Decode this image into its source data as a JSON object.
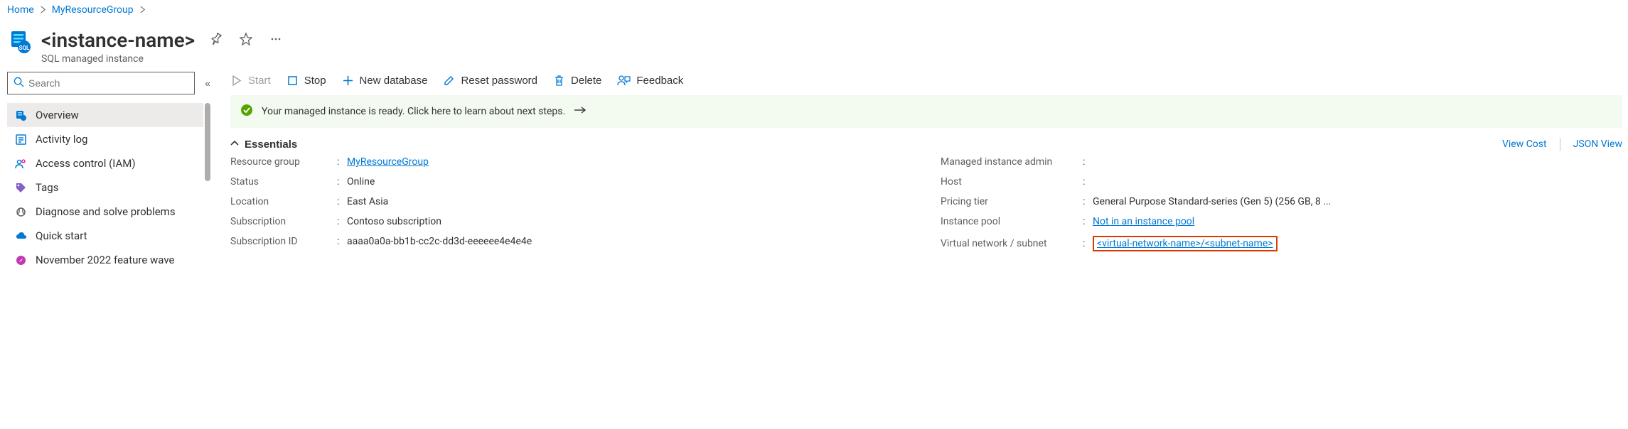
{
  "breadcrumb": {
    "home": "Home",
    "group": "MyResourceGroup"
  },
  "header": {
    "title": "<instance-name>",
    "subtitle": "SQL managed instance"
  },
  "search": {
    "placeholder": "Search",
    "collapse_glyph": "«"
  },
  "nav": {
    "items": [
      {
        "label": "Overview"
      },
      {
        "label": "Activity log"
      },
      {
        "label": "Access control (IAM)"
      },
      {
        "label": "Tags"
      },
      {
        "label": "Diagnose and solve problems"
      },
      {
        "label": "Quick start"
      },
      {
        "label": "November 2022 feature wave"
      }
    ]
  },
  "toolbar": {
    "start": "Start",
    "stop": "Stop",
    "new_database": "New database",
    "reset_password": "Reset password",
    "delete": "Delete",
    "feedback": "Feedback"
  },
  "alert": {
    "text": "Your managed instance is ready. Click here to learn about next steps."
  },
  "essentials": {
    "title": "Essentials",
    "view_cost": "View Cost",
    "json_view": "JSON View",
    "left": {
      "resource_group_label": "Resource group",
      "resource_group_value": "MyResourceGroup",
      "status_label": "Status",
      "status_value": "Online",
      "location_label": "Location",
      "location_value": "East Asia",
      "subscription_label": "Subscription",
      "subscription_value": "Contoso subscription",
      "subscription_id_label": "Subscription ID",
      "subscription_id_value": "aaaa0a0a-bb1b-cc2c-dd3d-eeeeee4e4e4e"
    },
    "right": {
      "admin_label": "Managed instance admin",
      "admin_value": "",
      "host_label": "Host",
      "host_value": "",
      "pricing_label": "Pricing tier",
      "pricing_value": "General Purpose Standard-series (Gen 5) (256 GB, 8 ...",
      "pool_label": "Instance pool",
      "pool_value": "Not in an instance pool",
      "vnet_label": "Virtual network / subnet",
      "vnet_value": "<virtual-network-name>/<subnet-name>"
    }
  }
}
